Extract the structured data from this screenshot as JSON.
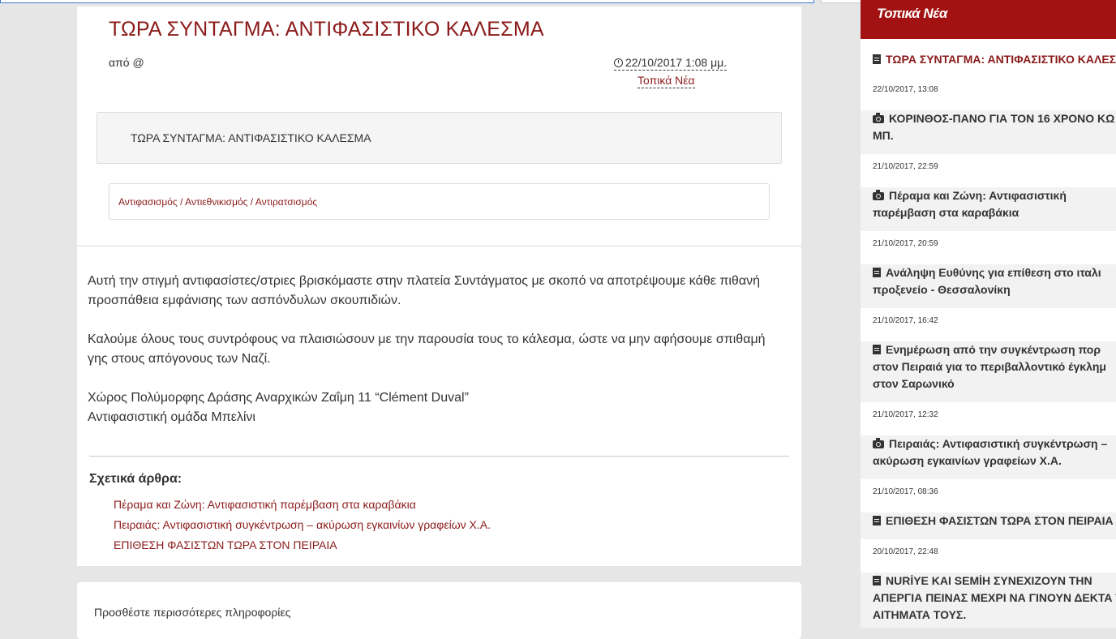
{
  "article": {
    "title": "ΤΩΡΑ ΣΥΝΤΑΓΜΑ: ΑΝΤΙΦΑΣΙΣΤΙΚΟ ΚΑΛΕΣΜΑ",
    "author_prefix": "από",
    "author": "@",
    "date": "22/10/2017 1:08 μμ.",
    "section": "Τοπικά Νέα",
    "summary": "ΤΩΡΑ ΣΥΝΤΑΓΜΑ: ΑΝΤΙΦΑΣΙΣΤΙΚΟ ΚΑΛΕΣΜΑ",
    "tags": [
      "Αντιφασισμός",
      "Αντιεθνικισμός",
      "Αντιρατσισμός"
    ],
    "paragraphs": [
      "Αυτή την στιγμή αντιφασίστες/στριες βρισκόμαστε στην πλατεία Συντάγματος με σκοπό να αποτρέψουμε κάθε πιθανή προσπάθεια εμφάνισης των ασπόνδυλων σκουπιδιών.",
      "Καλούμε όλους τους συντρόφους να πλαισιώσουν με την παρουσία τους το κάλεσμα, ώστε να μην αφήσουμε σπιθαμή γης στους απόγονους των Ναζί.",
      "Χώρος Πολύμορφης Δράσης Αναρχικών Ζαΐμη 11 “Clément Duval”",
      "Αντιφασιστική ομάδα Μπελίνι"
    ],
    "related_title": "Σχετικά άρθρα:",
    "related": [
      "Πέραμα και Ζώνη: Αντιφασιστική παρέμβαση στα καραβάκια",
      "Πειραιάς: Αντιφασιστική συγκέντρωση – ακύρωση εγκαινίων γραφείων Χ.Α.",
      "ΕΠΙΘΕΣΗ ΦΑΣΙΣΤΩΝ ΤΩΡΑ ΣΤΟΝ ΠΕΙΡΑΙΑ"
    ]
  },
  "more_info": {
    "label": "Προσθέστε περισσότερες πληροφορίες"
  },
  "sidebar": {
    "header": "Τοπικά Νέα",
    "items": [
      {
        "icon": "document-icon",
        "title": "ΤΩΡΑ ΣΥΝΤΑΓΜΑ: ΑΝΤΙΦΑΣΙΣΤΙΚΟ ΚΑΛΕΣΜΑ",
        "date": "22/10/2017, 13:08"
      },
      {
        "icon": "camera-icon",
        "title": "ΚΟΡΙΝΘΟΣ-ΠΑΝΟ ΓΙΑ ΤΟΝ 16 ΧΡΟΝΟ ΚΩ ΜΠ.",
        "date": "21/10/2017, 22:59"
      },
      {
        "icon": "camera-icon",
        "title": "Πέραμα και Ζώνη: Αντιφασιστική παρέμβαση στα καραβάκια",
        "date": "21/10/2017, 20:59"
      },
      {
        "icon": "document-icon",
        "title": "Ανάληψη Ευθύνης για επίθεση στο ιταλι προξενείο - Θεσσαλονίκη",
        "date": "21/10/2017, 16:42"
      },
      {
        "icon": "document-icon",
        "title": "Ενημέρωση από την συγκέντρωση πορ στον Πειραιά για το περιβαλλοντικό έγκλημ στον Σαρωνικό",
        "date": "21/10/2017, 12:32"
      },
      {
        "icon": "camera-icon",
        "title": "Πειραιάς: Αντιφασιστική συγκέντρωση – ακύρωση εγκαινίων γραφείων Χ.Α.",
        "date": "21/10/2017, 08:36"
      },
      {
        "icon": "document-icon",
        "title": "ΕΠΙΘΕΣΗ ΦΑΣΙΣΤΩΝ ΤΩΡΑ ΣΤΟΝ ΠΕΙΡΑΙΑ",
        "date": "20/10/2017, 22:48"
      },
      {
        "icon": "document-icon",
        "title": "NURİYE ΚΑΙ SEMİH ΣΥΝΕΧΙΖΟΥΝ ΤΗΝ ΑΠΕΡΓΙΑ ΠΕΙΝΑΣ ΜΕΧΡΙ ΝΑ ΓΙΝΟΥΝ ΔΕΚΤΑ Τ ΑΙΤΗΜΑΤΑ ΤΟΥΣ.",
        "date": ""
      }
    ]
  },
  "colors": {
    "accent": "#8b1a1a",
    "header_bg": "#a31212",
    "page_bg": "#e6e6e6"
  }
}
